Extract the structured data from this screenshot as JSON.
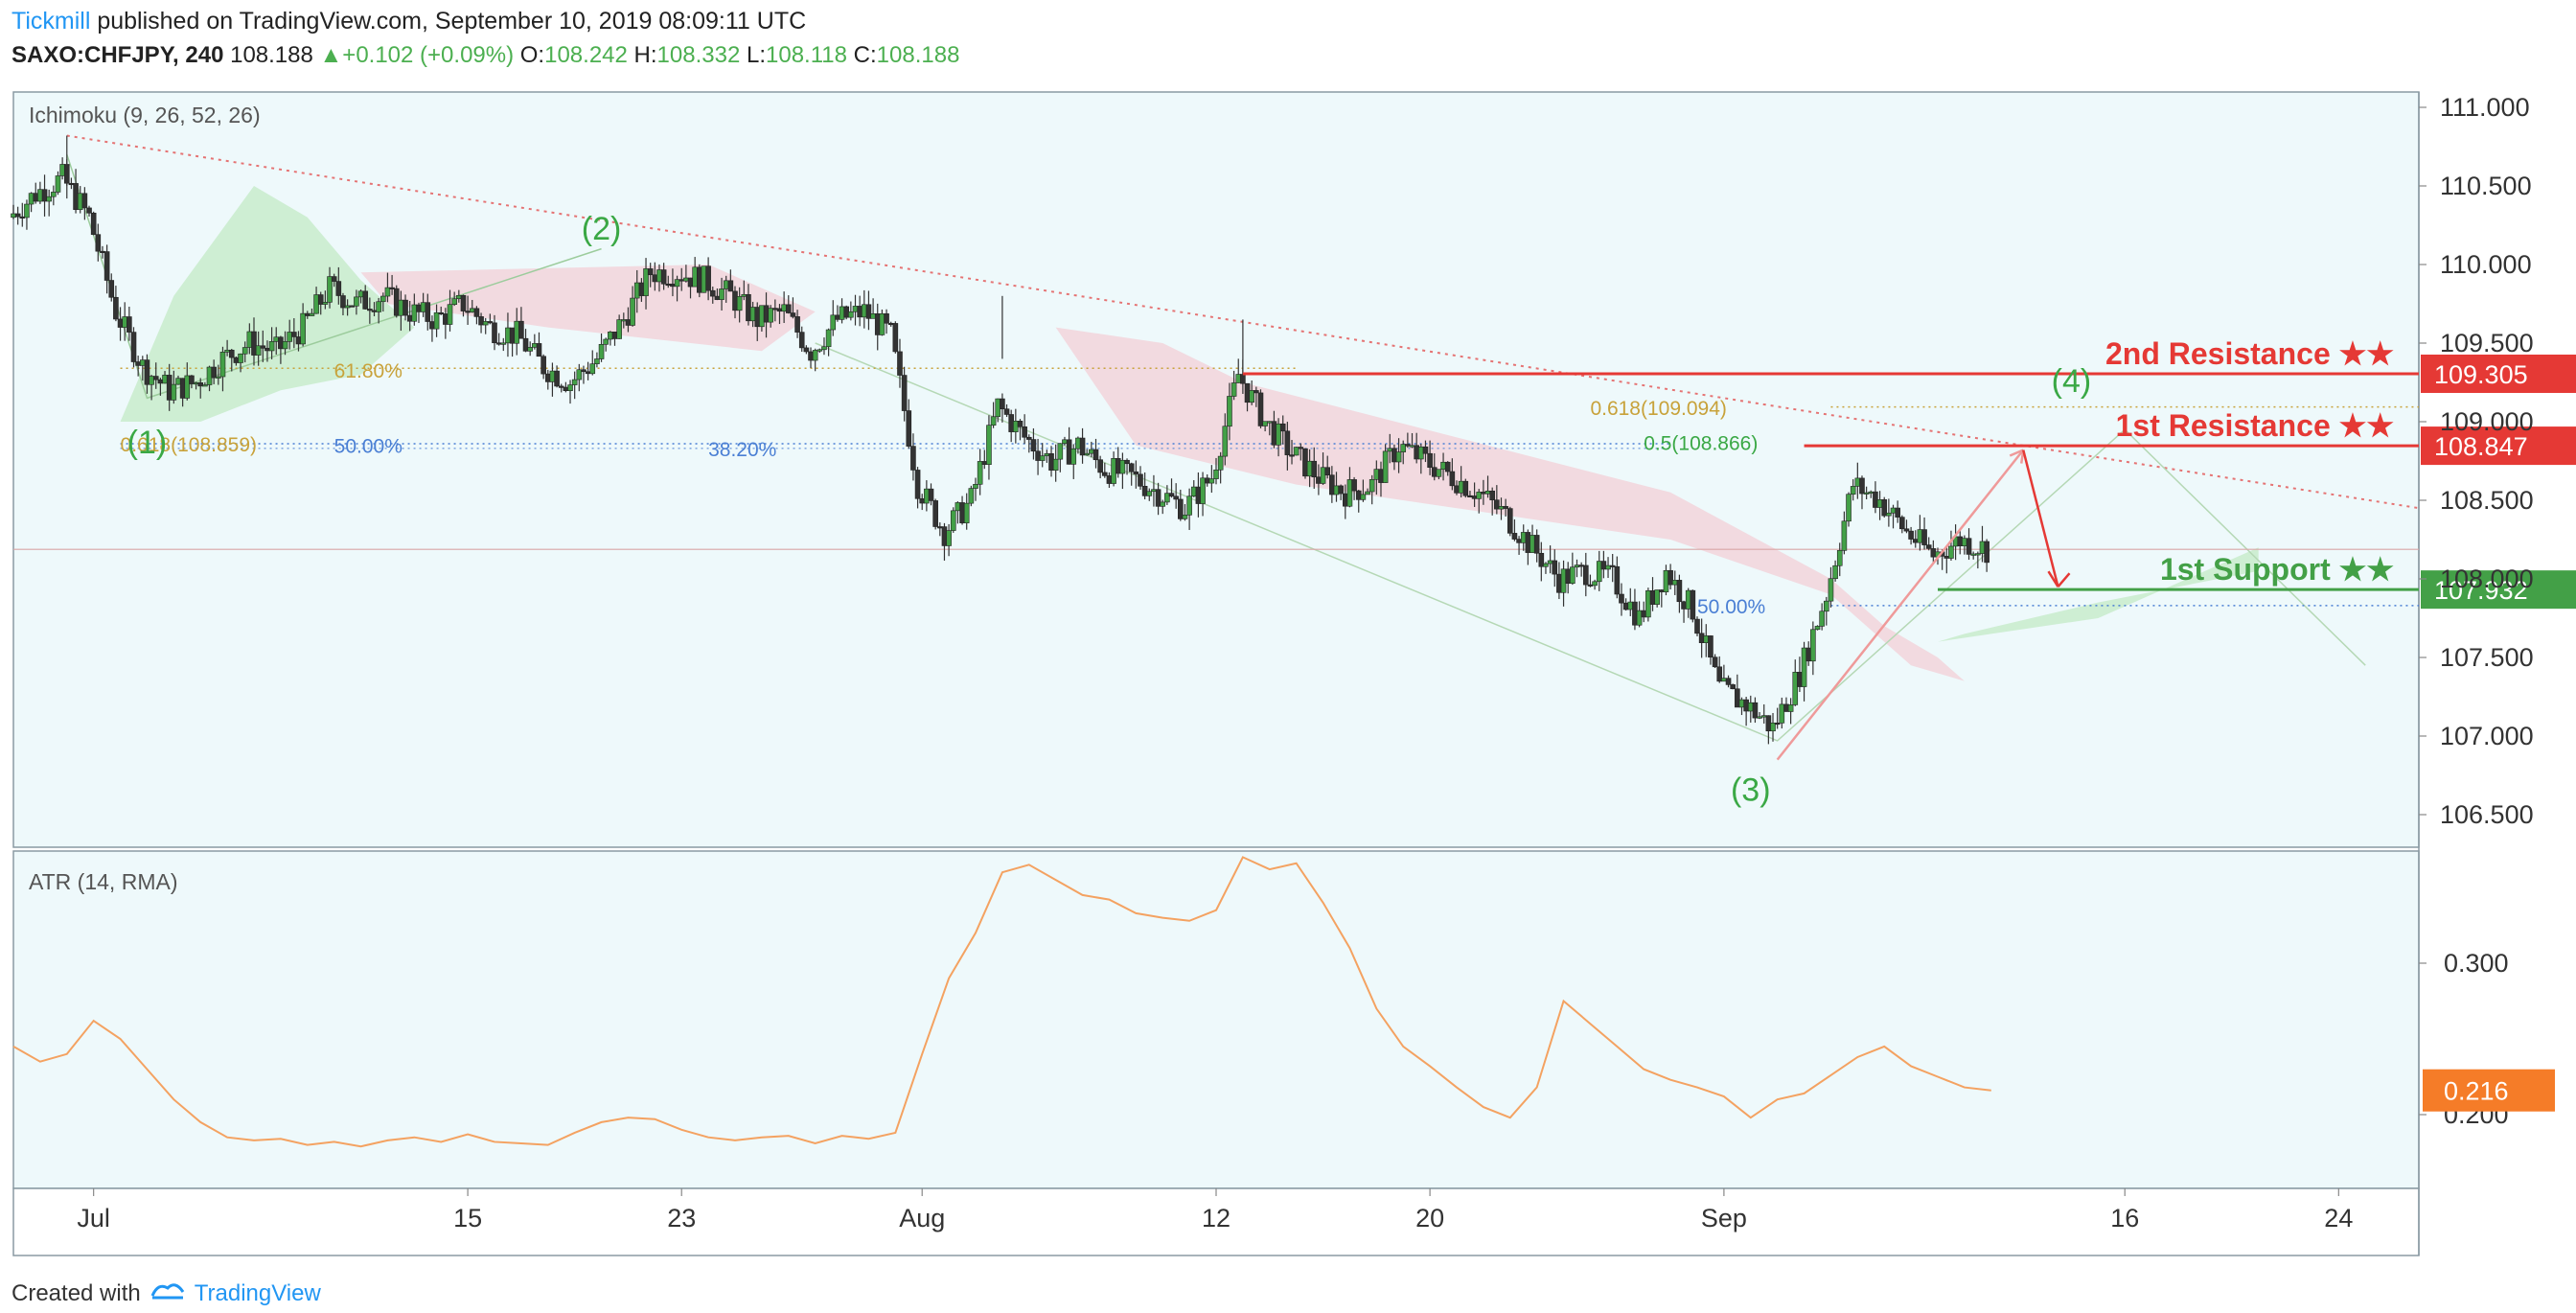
{
  "header": {
    "author": "Tickmill",
    "published": " published on TradingView.com, September 10, 2019 08:09:11 UTC",
    "symbol": "SAXO:CHFJPY, 240",
    "last": "108.188",
    "change": "+0.102 (+0.09%)",
    "o_label": "O:",
    "o": "108.242",
    "h_label": "H:",
    "h": "108.332",
    "l_label": "L:",
    "l": "108.118",
    "c_label": "C:",
    "c": "108.188"
  },
  "footer": {
    "created": "Created with",
    "brand": "TradingView"
  },
  "colors": {
    "panel_bg": "#eef9fb",
    "resistance": "#e53935",
    "support": "#43a047",
    "candle_up": "#43a047",
    "candle_down": "#333333",
    "atr": "#f4a261",
    "fib_gold": "#c8a23a",
    "fib_blue": "#4a7fd4",
    "wave": "#3aa845",
    "atr_badge": "#f57c28"
  },
  "chart_data": [
    {
      "type": "candlestick",
      "title": "Ichimoku (9, 26, 52, 26)",
      "ylim": [
        106.5,
        111.2
      ],
      "yticks": [
        "111.000",
        "110.500",
        "110.000",
        "109.500",
        "109.000",
        "108.500",
        "108.000",
        "107.500",
        "107.000",
        "106.500"
      ],
      "x_ticks": [
        "Jul",
        "15",
        "23",
        "Aug",
        "12",
        "20",
        "Sep",
        "16",
        "24"
      ],
      "x_tick_days": [
        1,
        15,
        23,
        32,
        43,
        51,
        62,
        77,
        85
      ],
      "x_range_days": [
        -2,
        88
      ],
      "close_path": [
        [
          -2,
          110.3
        ],
        [
          -1,
          110.45
        ],
        [
          0,
          110.55
        ],
        [
          1,
          110.3
        ],
        [
          2,
          109.7
        ],
        [
          3,
          109.35
        ],
        [
          4,
          109.2
        ],
        [
          5,
          109.25
        ],
        [
          6,
          109.4
        ],
        [
          7,
          109.5
        ],
        [
          8,
          109.45
        ],
        [
          9,
          109.6
        ],
        [
          10,
          109.85
        ],
        [
          11,
          109.75
        ],
        [
          12,
          109.8
        ],
        [
          13,
          109.7
        ],
        [
          14,
          109.65
        ],
        [
          15,
          109.75
        ],
        [
          16,
          109.6
        ],
        [
          17,
          109.55
        ],
        [
          18,
          109.35
        ],
        [
          19,
          109.25
        ],
        [
          20,
          109.4
        ],
        [
          21,
          109.65
        ],
        [
          22,
          109.95
        ],
        [
          23,
          109.95
        ],
        [
          24,
          109.9
        ],
        [
          25,
          109.8
        ],
        [
          26,
          109.65
        ],
        [
          27,
          109.7
        ],
        [
          28,
          109.45
        ],
        [
          29,
          109.65
        ],
        [
          30,
          109.7
        ],
        [
          31,
          109.55
        ],
        [
          32,
          108.6
        ],
        [
          33,
          108.3
        ],
        [
          34,
          108.5
        ],
        [
          35,
          109.1
        ],
        [
          36,
          108.9
        ],
        [
          37,
          108.75
        ],
        [
          38,
          108.85
        ],
        [
          39,
          108.7
        ],
        [
          40,
          108.65
        ],
        [
          41,
          108.55
        ],
        [
          42,
          108.45
        ],
        [
          43,
          108.65
        ],
        [
          44,
          109.3
        ],
        [
          45,
          109.0
        ],
        [
          46,
          108.8
        ],
        [
          47,
          108.65
        ],
        [
          48,
          108.55
        ],
        [
          49,
          108.6
        ],
        [
          50,
          108.85
        ],
        [
          51,
          108.75
        ],
        [
          52,
          108.65
        ],
        [
          53,
          108.55
        ],
        [
          54,
          108.4
        ],
        [
          55,
          108.2
        ],
        [
          56,
          108.0
        ],
        [
          57,
          108.05
        ],
        [
          58,
          108.0
        ],
        [
          59,
          107.75
        ],
        [
          60,
          108.05
        ],
        [
          61,
          107.8
        ],
        [
          62,
          107.3
        ],
        [
          63,
          107.2
        ],
        [
          64,
          107.05
        ],
        [
          65,
          107.4
        ],
        [
          66,
          107.9
        ],
        [
          67,
          108.6
        ],
        [
          68,
          108.5
        ],
        [
          69,
          108.3
        ],
        [
          70,
          108.15
        ],
        [
          71,
          108.25
        ],
        [
          72,
          108.19
        ]
      ],
      "atr_panel": {
        "title": "ATR (14, RMA)",
        "yticks": [
          "0.300",
          "0.200"
        ],
        "ylim": [
          0.17,
          0.38
        ],
        "current": "0.216",
        "values": [
          [
            -2,
            0.245
          ],
          [
            -1,
            0.235
          ],
          [
            0,
            0.24
          ],
          [
            1,
            0.262
          ],
          [
            2,
            0.25
          ],
          [
            3,
            0.23
          ],
          [
            4,
            0.21
          ],
          [
            5,
            0.195
          ],
          [
            6,
            0.185
          ],
          [
            7,
            0.183
          ],
          [
            8,
            0.184
          ],
          [
            9,
            0.18
          ],
          [
            10,
            0.182
          ],
          [
            11,
            0.179
          ],
          [
            12,
            0.183
          ],
          [
            13,
            0.185
          ],
          [
            14,
            0.182
          ],
          [
            15,
            0.187
          ],
          [
            16,
            0.182
          ],
          [
            17,
            0.181
          ],
          [
            18,
            0.18
          ],
          [
            19,
            0.188
          ],
          [
            20,
            0.195
          ],
          [
            21,
            0.198
          ],
          [
            22,
            0.197
          ],
          [
            23,
            0.19
          ],
          [
            24,
            0.185
          ],
          [
            25,
            0.183
          ],
          [
            26,
            0.185
          ],
          [
            27,
            0.186
          ],
          [
            28,
            0.181
          ],
          [
            29,
            0.186
          ],
          [
            30,
            0.184
          ],
          [
            31,
            0.188
          ],
          [
            32,
            0.24
          ],
          [
            33,
            0.29
          ],
          [
            34,
            0.32
          ],
          [
            35,
            0.36
          ],
          [
            36,
            0.365
          ],
          [
            37,
            0.355
          ],
          [
            38,
            0.345
          ],
          [
            39,
            0.342
          ],
          [
            40,
            0.333
          ],
          [
            41,
            0.33
          ],
          [
            42,
            0.328
          ],
          [
            43,
            0.335
          ],
          [
            44,
            0.37
          ],
          [
            45,
            0.362
          ],
          [
            46,
            0.366
          ],
          [
            47,
            0.34
          ],
          [
            48,
            0.31
          ],
          [
            49,
            0.27
          ],
          [
            50,
            0.245
          ],
          [
            51,
            0.232
          ],
          [
            52,
            0.218
          ],
          [
            53,
            0.205
          ],
          [
            54,
            0.198
          ],
          [
            55,
            0.218
          ],
          [
            56,
            0.275
          ],
          [
            57,
            0.26
          ],
          [
            58,
            0.245
          ],
          [
            59,
            0.23
          ],
          [
            60,
            0.223
          ],
          [
            61,
            0.218
          ],
          [
            62,
            0.212
          ],
          [
            63,
            0.198
          ],
          [
            64,
            0.21
          ],
          [
            65,
            0.214
          ],
          [
            66,
            0.226
          ],
          [
            67,
            0.238
          ],
          [
            68,
            0.245
          ],
          [
            69,
            0.232
          ],
          [
            70,
            0.225
          ],
          [
            71,
            0.218
          ],
          [
            72,
            0.216
          ]
        ]
      },
      "levels": [
        {
          "name": "2nd Resistance ★★",
          "value": 109.305,
          "label": "109.305",
          "kind": "resistance"
        },
        {
          "name": "1st Resistance ★★",
          "value": 108.847,
          "label": "108.847",
          "kind": "resistance"
        },
        {
          "name": "1st Support ★★",
          "value": 107.932,
          "label": "107.932",
          "kind": "support"
        }
      ],
      "last_price_line": 108.188,
      "fib_labels": [
        {
          "text": "61.80%",
          "day": 10,
          "value": 109.33,
          "color": "gold"
        },
        {
          "text": "50.00%",
          "day": 10,
          "value": 108.85,
          "color": "blue"
        },
        {
          "text": "38.20%",
          "day": 24,
          "value": 108.83,
          "color": "blue"
        },
        {
          "text": "0.618(108.859)",
          "day": 2,
          "value": 108.86,
          "color": "gold"
        },
        {
          "text": "0.618(109.094)",
          "day": 57,
          "value": 109.09,
          "color": "gold"
        },
        {
          "text": "0.5(108.866)",
          "day": 59,
          "value": 108.87,
          "color": "wave"
        },
        {
          "text": "50.00%",
          "day": 61,
          "value": 107.83,
          "color": "blue"
        }
      ],
      "wave_labels": [
        {
          "text": "(1)",
          "day": 3,
          "value": 108.86
        },
        {
          "text": "(2)",
          "day": 20,
          "value": 110.22
        },
        {
          "text": "(3)",
          "day": 63,
          "value": 106.65
        },
        {
          "text": "(4)",
          "day": 75,
          "value": 109.25
        }
      ]
    }
  ]
}
